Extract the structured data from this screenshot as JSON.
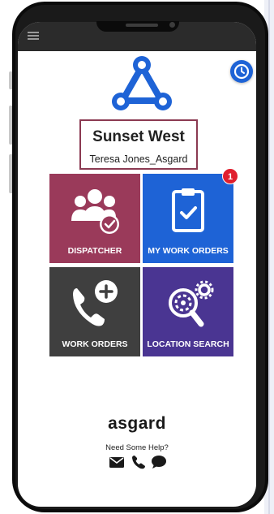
{
  "header": {
    "menu_icon": "hamburger-icon"
  },
  "logo": {
    "icon": "tri-node-logo",
    "color": "#1e63d6"
  },
  "history_button": {
    "icon": "clock-icon",
    "color": "#1e63d6"
  },
  "site": {
    "name": "Sunset West",
    "user": "Teresa Jones_Asgard",
    "border_color": "#8b3a52"
  },
  "tiles": [
    {
      "label": "DISPATCHER",
      "icon": "team-check-icon",
      "color": "#9a3a5a"
    },
    {
      "label": "MY WORK ORDERS",
      "icon": "clipboard-check-icon",
      "color": "#1e63d6",
      "badge": "1"
    },
    {
      "label": "WORK ORDERS",
      "icon": "phone-plus-icon",
      "color": "#3f3f3f"
    },
    {
      "label": "LOCATION SEARCH",
      "icon": "search-gear-icon",
      "color": "#4a3592"
    }
  ],
  "footer": {
    "brand": "asgard",
    "help_text": "Need Some Help?",
    "contact_icons": [
      "envelope-icon",
      "phone-icon",
      "chat-icon"
    ]
  }
}
